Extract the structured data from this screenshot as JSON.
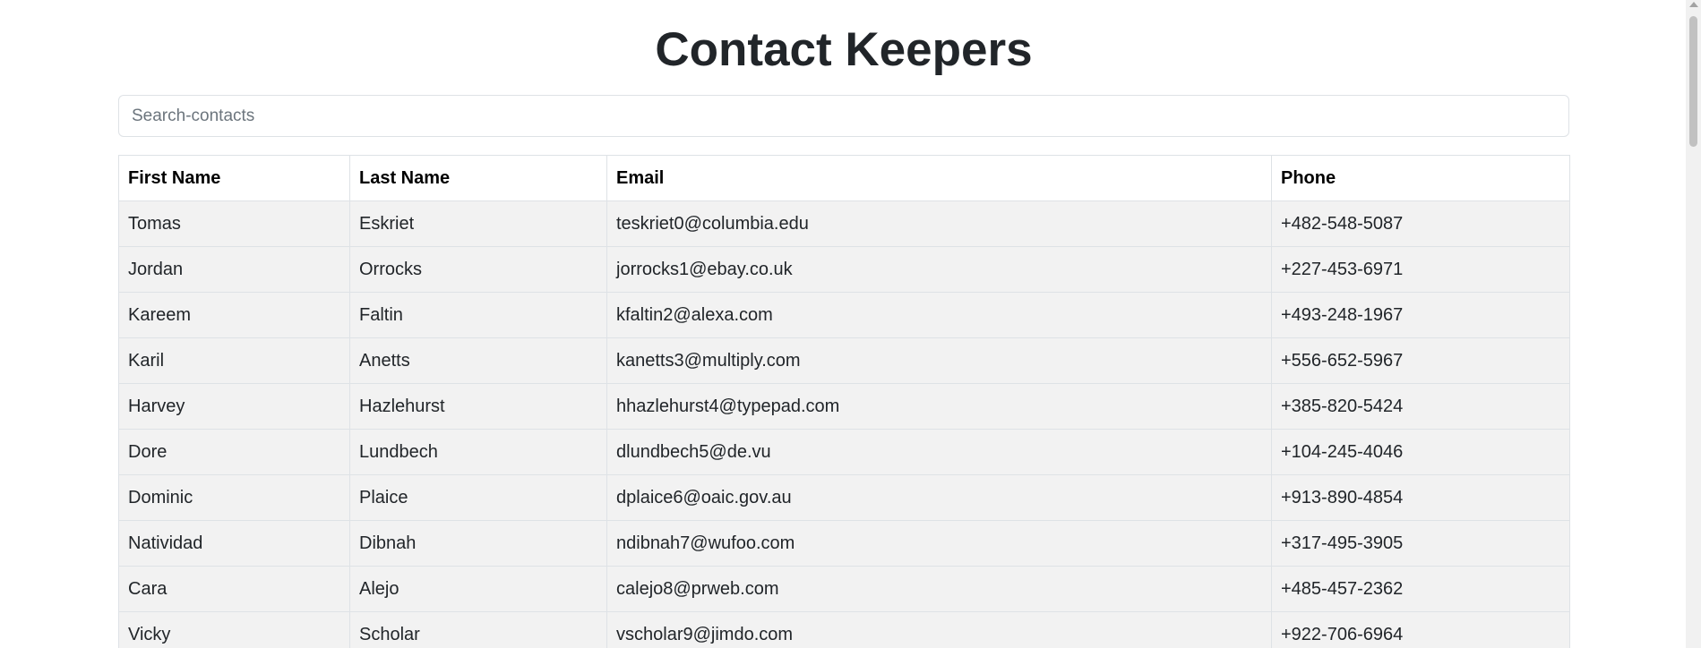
{
  "page": {
    "title": "Contact Keepers"
  },
  "search": {
    "placeholder": "Search-contacts",
    "value": ""
  },
  "table": {
    "headers": [
      "First Name",
      "Last Name",
      "Email",
      "Phone"
    ],
    "rows": [
      [
        "Tomas",
        "Eskriet",
        "teskriet0@columbia.edu",
        "+482-548-5087"
      ],
      [
        "Jordan",
        "Orrocks",
        "jorrocks1@ebay.co.uk",
        "+227-453-6971"
      ],
      [
        "Kareem",
        "Faltin",
        "kfaltin2@alexa.com",
        "+493-248-1967"
      ],
      [
        "Karil",
        "Anetts",
        "kanetts3@multiply.com",
        "+556-652-5967"
      ],
      [
        "Harvey",
        "Hazlehurst",
        "hhazlehurst4@typepad.com",
        "+385-820-5424"
      ],
      [
        "Dore",
        "Lundbech",
        "dlundbech5@de.vu",
        "+104-245-4046"
      ],
      [
        "Dominic",
        "Plaice",
        "dplaice6@oaic.gov.au",
        "+913-890-4854"
      ],
      [
        "Natividad",
        "Dibnah",
        "ndibnah7@wufoo.com",
        "+317-495-3905"
      ],
      [
        "Cara",
        "Alejo",
        "calejo8@prweb.com",
        "+485-457-2362"
      ],
      [
        "Vicky",
        "Scholar",
        "vscholar9@jimdo.com",
        "+922-706-6964"
      ]
    ]
  },
  "colors": {
    "row_background": "#f2f2f2",
    "border": "#dee2e6",
    "title_text": "#212529"
  },
  "icons": {
    "scroll_up": "scroll-up-arrow-icon"
  }
}
